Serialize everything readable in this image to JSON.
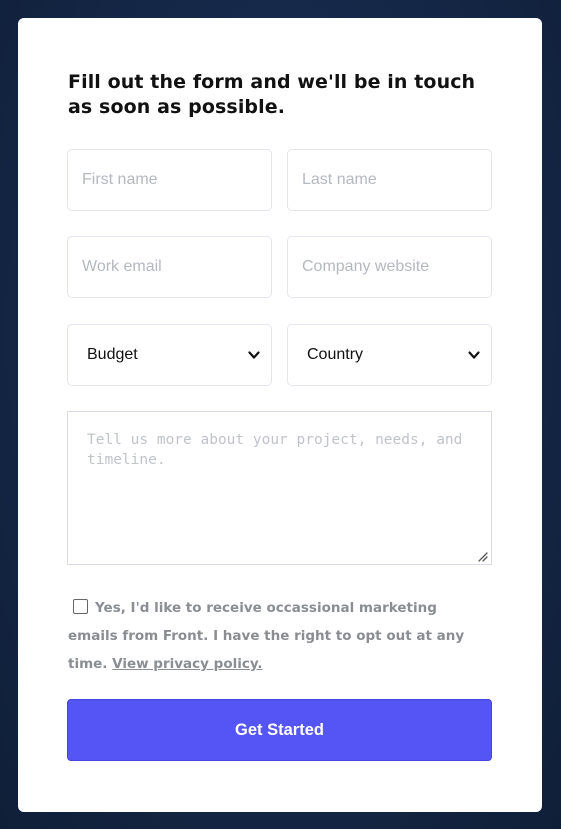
{
  "form": {
    "heading": "Fill out the form and we'll be in touch as soon as possible.",
    "first_name": {
      "placeholder": "First name",
      "value": ""
    },
    "last_name": {
      "placeholder": "Last name",
      "value": ""
    },
    "work_email": {
      "placeholder": "Work email",
      "value": ""
    },
    "company_website": {
      "placeholder": "Company website",
      "value": ""
    },
    "budget": {
      "selected": "Budget",
      "icon": "chevron-down-icon"
    },
    "country": {
      "selected": "Country",
      "icon": "chevron-down-icon"
    },
    "message": {
      "placeholder": "Tell us more about your project, needs, and timeline.",
      "value": ""
    },
    "consent": {
      "checked": false,
      "text": "Yes, I'd like to receive occassional marketing emails from Front. I have the right to opt out at any time.",
      "link_text": "View privacy policy."
    },
    "submit_label": "Get Started"
  },
  "colors": {
    "background": "#16294a",
    "card": "#ffffff",
    "button": "#5555f5",
    "button_text": "#ffffff",
    "muted_text": "#8a8d92"
  }
}
